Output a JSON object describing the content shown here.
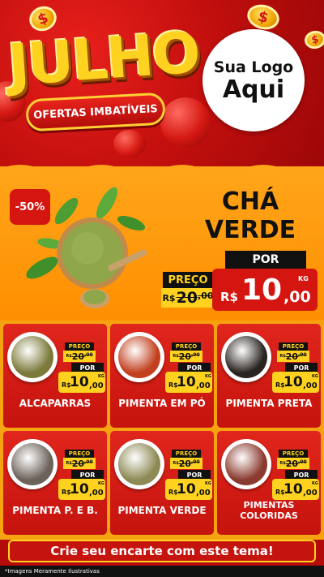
{
  "header": {
    "title": "JULHO",
    "subtitle": "OFERTAS IMBATÍVEIS",
    "logo_line1": "Sua Logo",
    "logo_line2": "Aqui",
    "coin_symbol": "$"
  },
  "featured": {
    "discount_badge": "-50%",
    "name_line1": "CHÁ",
    "name_line2": "VERDE",
    "old_label": "PREÇO",
    "old_prefix": "R$",
    "old_whole": "20",
    "old_cents": ",00",
    "new_label": "POR",
    "new_prefix": "R$",
    "new_whole": "10",
    "new_cents": ",00",
    "unit": "KG"
  },
  "products": [
    {
      "name": "ALCAPARRAS",
      "old_label": "PREÇO",
      "old_prefix": "R$",
      "old_whole": "20",
      "old_cents": ",00",
      "new_label": "POR",
      "new_prefix": "R$",
      "new_whole": "10",
      "new_cents": ",00",
      "unit": "KG",
      "color": "#7b7a3a"
    },
    {
      "name": "PIMENTA EM PÓ",
      "old_label": "PREÇO",
      "old_prefix": "R$",
      "old_whole": "20",
      "old_cents": ",00",
      "new_label": "POR",
      "new_prefix": "R$",
      "new_whole": "10",
      "new_cents": ",00",
      "unit": "KG",
      "color": "#c2401e"
    },
    {
      "name": "PIMENTA PRETA",
      "old_label": "PREÇO",
      "old_prefix": "R$",
      "old_whole": "20",
      "old_cents": ",00",
      "new_label": "POR",
      "new_prefix": "R$",
      "new_whole": "10",
      "new_cents": ",00",
      "unit": "KG",
      "color": "#2a2420"
    },
    {
      "name": "PIMENTA P. E B.",
      "old_label": "PREÇO",
      "old_prefix": "R$",
      "old_whole": "20",
      "old_cents": ",00",
      "new_label": "POR",
      "new_prefix": "R$",
      "new_whole": "10",
      "new_cents": ",00",
      "unit": "KG",
      "color": "#6c625a"
    },
    {
      "name": "PIMENTA VERDE",
      "old_label": "PREÇO",
      "old_prefix": "R$",
      "old_whole": "20",
      "old_cents": ",00",
      "new_label": "POR",
      "new_prefix": "R$",
      "new_whole": "10",
      "new_cents": ",00",
      "unit": "KG",
      "color": "#8d8a55"
    },
    {
      "name": "PIMENTAS COLORIDAS",
      "old_label": "PREÇO",
      "old_prefix": "R$",
      "old_whole": "20",
      "old_cents": ",00",
      "new_label": "POR",
      "new_prefix": "R$",
      "new_whole": "10",
      "new_cents": ",00",
      "unit": "KG",
      "color": "#8a3a2e"
    }
  ],
  "cta": "Crie seu encarte com este tema!",
  "footnote": "*Imagens Meramente Ilustrativas"
}
